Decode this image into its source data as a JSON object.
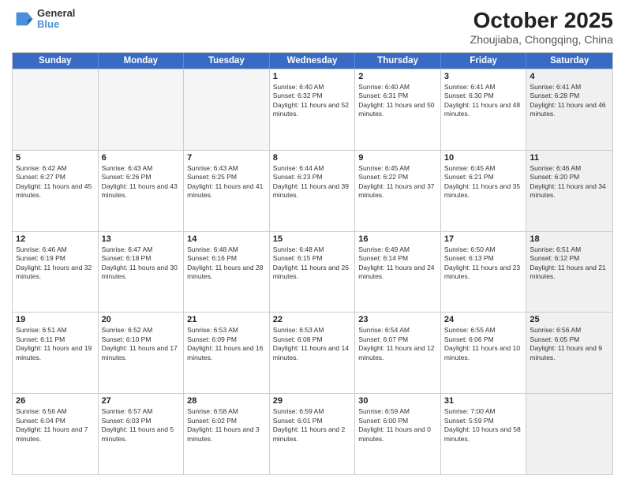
{
  "header": {
    "logo_line1": "General",
    "logo_line2": "Blue",
    "title": "October 2025",
    "subtitle": "Zhoujiaba, Chongqing, China"
  },
  "days_of_week": [
    "Sunday",
    "Monday",
    "Tuesday",
    "Wednesday",
    "Thursday",
    "Friday",
    "Saturday"
  ],
  "weeks": [
    [
      {
        "day": "",
        "empty": true
      },
      {
        "day": "",
        "empty": true
      },
      {
        "day": "",
        "empty": true
      },
      {
        "day": "1",
        "sunrise": "6:40 AM",
        "sunset": "6:32 PM",
        "daylight": "11 hours and 52 minutes."
      },
      {
        "day": "2",
        "sunrise": "6:40 AM",
        "sunset": "6:31 PM",
        "daylight": "11 hours and 50 minutes."
      },
      {
        "day": "3",
        "sunrise": "6:41 AM",
        "sunset": "6:30 PM",
        "daylight": "11 hours and 48 minutes."
      },
      {
        "day": "4",
        "sunrise": "6:41 AM",
        "sunset": "6:28 PM",
        "daylight": "11 hours and 46 minutes.",
        "shaded": true
      }
    ],
    [
      {
        "day": "5",
        "sunrise": "6:42 AM",
        "sunset": "6:27 PM",
        "daylight": "11 hours and 45 minutes."
      },
      {
        "day": "6",
        "sunrise": "6:43 AM",
        "sunset": "6:26 PM",
        "daylight": "11 hours and 43 minutes."
      },
      {
        "day": "7",
        "sunrise": "6:43 AM",
        "sunset": "6:25 PM",
        "daylight": "11 hours and 41 minutes."
      },
      {
        "day": "8",
        "sunrise": "6:44 AM",
        "sunset": "6:23 PM",
        "daylight": "11 hours and 39 minutes."
      },
      {
        "day": "9",
        "sunrise": "6:45 AM",
        "sunset": "6:22 PM",
        "daylight": "11 hours and 37 minutes."
      },
      {
        "day": "10",
        "sunrise": "6:45 AM",
        "sunset": "6:21 PM",
        "daylight": "11 hours and 35 minutes."
      },
      {
        "day": "11",
        "sunrise": "6:46 AM",
        "sunset": "6:20 PM",
        "daylight": "11 hours and 34 minutes.",
        "shaded": true
      }
    ],
    [
      {
        "day": "12",
        "sunrise": "6:46 AM",
        "sunset": "6:19 PM",
        "daylight": "11 hours and 32 minutes."
      },
      {
        "day": "13",
        "sunrise": "6:47 AM",
        "sunset": "6:18 PM",
        "daylight": "11 hours and 30 minutes."
      },
      {
        "day": "14",
        "sunrise": "6:48 AM",
        "sunset": "6:16 PM",
        "daylight": "11 hours and 28 minutes."
      },
      {
        "day": "15",
        "sunrise": "6:48 AM",
        "sunset": "6:15 PM",
        "daylight": "11 hours and 26 minutes."
      },
      {
        "day": "16",
        "sunrise": "6:49 AM",
        "sunset": "6:14 PM",
        "daylight": "11 hours and 24 minutes."
      },
      {
        "day": "17",
        "sunrise": "6:50 AM",
        "sunset": "6:13 PM",
        "daylight": "11 hours and 23 minutes."
      },
      {
        "day": "18",
        "sunrise": "6:51 AM",
        "sunset": "6:12 PM",
        "daylight": "11 hours and 21 minutes.",
        "shaded": true
      }
    ],
    [
      {
        "day": "19",
        "sunrise": "6:51 AM",
        "sunset": "6:11 PM",
        "daylight": "11 hours and 19 minutes."
      },
      {
        "day": "20",
        "sunrise": "6:52 AM",
        "sunset": "6:10 PM",
        "daylight": "11 hours and 17 minutes."
      },
      {
        "day": "21",
        "sunrise": "6:53 AM",
        "sunset": "6:09 PM",
        "daylight": "11 hours and 16 minutes."
      },
      {
        "day": "22",
        "sunrise": "6:53 AM",
        "sunset": "6:08 PM",
        "daylight": "11 hours and 14 minutes."
      },
      {
        "day": "23",
        "sunrise": "6:54 AM",
        "sunset": "6:07 PM",
        "daylight": "11 hours and 12 minutes."
      },
      {
        "day": "24",
        "sunrise": "6:55 AM",
        "sunset": "6:06 PM",
        "daylight": "11 hours and 10 minutes."
      },
      {
        "day": "25",
        "sunrise": "6:56 AM",
        "sunset": "6:05 PM",
        "daylight": "11 hours and 9 minutes.",
        "shaded": true
      }
    ],
    [
      {
        "day": "26",
        "sunrise": "6:56 AM",
        "sunset": "6:04 PM",
        "daylight": "11 hours and 7 minutes."
      },
      {
        "day": "27",
        "sunrise": "6:57 AM",
        "sunset": "6:03 PM",
        "daylight": "11 hours and 5 minutes."
      },
      {
        "day": "28",
        "sunrise": "6:58 AM",
        "sunset": "6:02 PM",
        "daylight": "11 hours and 3 minutes."
      },
      {
        "day": "29",
        "sunrise": "6:59 AM",
        "sunset": "6:01 PM",
        "daylight": "11 hours and 2 minutes."
      },
      {
        "day": "30",
        "sunrise": "6:59 AM",
        "sunset": "6:00 PM",
        "daylight": "11 hours and 0 minutes."
      },
      {
        "day": "31",
        "sunrise": "7:00 AM",
        "sunset": "5:59 PM",
        "daylight": "10 hours and 58 minutes."
      },
      {
        "day": "",
        "empty": true,
        "shaded": true
      }
    ]
  ]
}
